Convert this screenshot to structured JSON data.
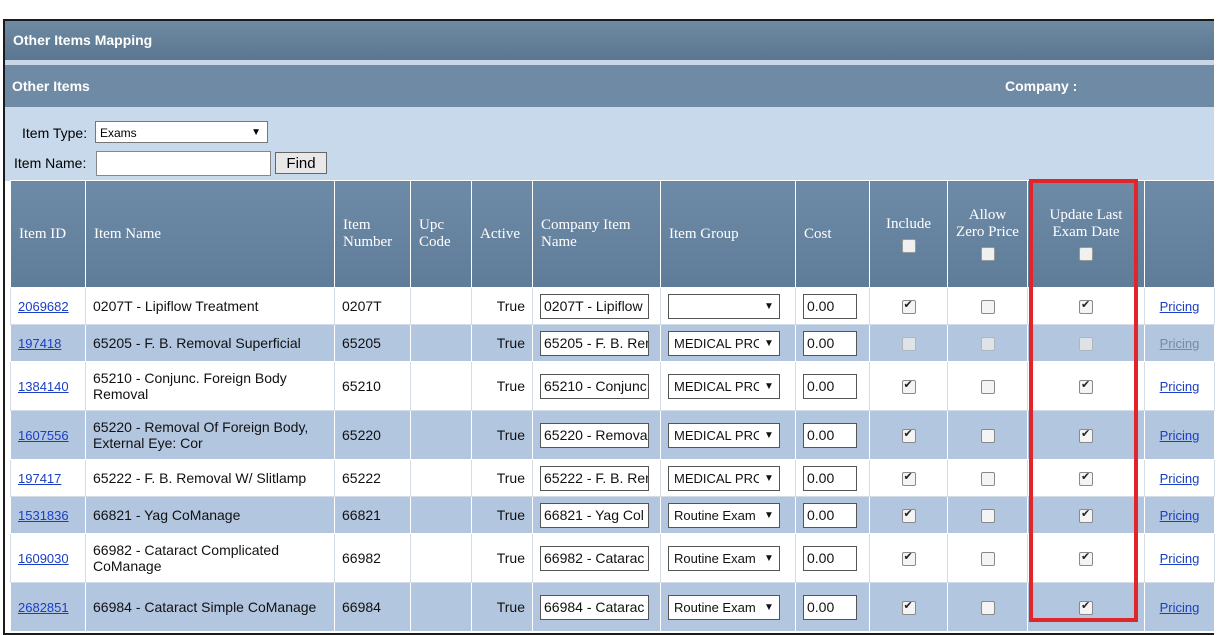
{
  "title": "Other Items Mapping",
  "section": {
    "left": "Other Items",
    "right": "Company :"
  },
  "filter": {
    "item_type_label": "Item Type:",
    "item_type_value": "Exams",
    "item_name_label": "Item Name:",
    "item_name_value": "",
    "find_label": "Find"
  },
  "headers": {
    "item_id": "Item ID",
    "item_name": "Item Name",
    "item_number": "Item Number",
    "upc_code": "Upc Code",
    "active": "Active",
    "company_item_name": "Company Item Name",
    "item_group": "Item Group",
    "cost": "Cost",
    "include": "Include",
    "allow_zero_price": "Allow Zero Price",
    "update_last_exam_date": "Update Last Exam Date"
  },
  "rows": [
    {
      "id": "2069682",
      "name": "0207T - Lipiflow Treatment",
      "number": "0207T",
      "active": "True",
      "company_name": "0207T - Lipiflow",
      "group": "",
      "cost": "0.00",
      "include": true,
      "allow_zero": false,
      "update_exam": true,
      "enabled": true,
      "pricing": "Pricing"
    },
    {
      "id": "197418",
      "name": "65205 - F. B. Removal Superficial",
      "number": "65205",
      "active": "True",
      "company_name": "65205 - F. B. Rem",
      "group": "MEDICAL PRO",
      "cost": "0.00",
      "include": false,
      "allow_zero": false,
      "update_exam": false,
      "enabled": false,
      "pricing": "Pricing"
    },
    {
      "id": "1384140",
      "name": "65210 - Conjunc. Foreign Body Removal",
      "number": "65210",
      "active": "True",
      "company_name": "65210 - Conjunc",
      "group": "MEDICAL PRO",
      "cost": "0.00",
      "include": true,
      "allow_zero": false,
      "update_exam": true,
      "enabled": true,
      "pricing": "Pricing"
    },
    {
      "id": "1607556",
      "name": "65220 - Removal Of Foreign Body, External Eye: Cor",
      "number": "65220",
      "active": "True",
      "company_name": "65220 - Remova",
      "group": "MEDICAL PRO",
      "cost": "0.00",
      "include": true,
      "allow_zero": false,
      "update_exam": true,
      "enabled": true,
      "pricing": "Pricing"
    },
    {
      "id": "197417",
      "name": "65222 - F. B. Removal W/ Slitlamp",
      "number": "65222",
      "active": "True",
      "company_name": "65222 - F. B. Rem",
      "group": "MEDICAL PRO",
      "cost": "0.00",
      "include": true,
      "allow_zero": false,
      "update_exam": true,
      "enabled": true,
      "pricing": "Pricing"
    },
    {
      "id": "1531836",
      "name": "66821 - Yag CoManage",
      "number": "66821",
      "active": "True",
      "company_name": "66821 - Yag Col",
      "group": "Routine Exam",
      "cost": "0.00",
      "include": true,
      "allow_zero": false,
      "update_exam": true,
      "enabled": true,
      "pricing": "Pricing"
    },
    {
      "id": "1609030",
      "name": "66982 - Cataract Complicated CoManage",
      "number": "66982",
      "active": "True",
      "company_name": "66982 - Catarac",
      "group": "Routine Exam",
      "cost": "0.00",
      "include": true,
      "allow_zero": false,
      "update_exam": true,
      "enabled": true,
      "pricing": "Pricing"
    },
    {
      "id": "2682851",
      "name": "66984 - Cataract Simple CoManage",
      "number": "66984",
      "active": "True",
      "company_name": "66984 - Catarac",
      "group": "Routine Exam",
      "cost": "0.00",
      "include": true,
      "allow_zero": false,
      "update_exam": true,
      "enabled": true,
      "pricing": "Pricing"
    }
  ]
}
